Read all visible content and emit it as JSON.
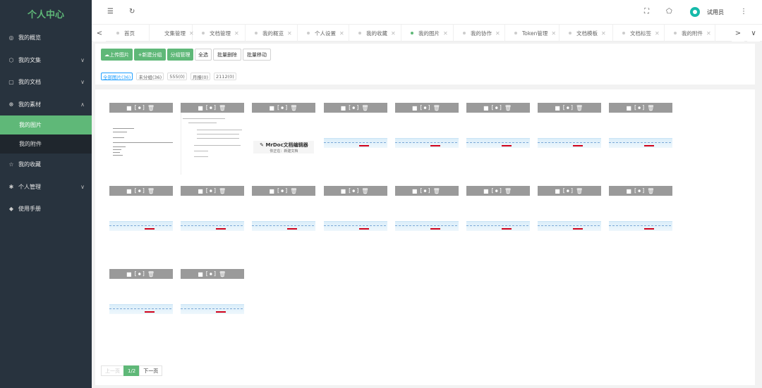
{
  "app": {
    "title": "个人中心"
  },
  "sidebar": {
    "items": [
      {
        "label": "我的概览",
        "icon": "dashboard-icon",
        "glyph": "◎"
      },
      {
        "label": "我的文集",
        "icon": "cube-icon",
        "glyph": "⬡",
        "chevron": "∨"
      },
      {
        "label": "我的文档",
        "icon": "document-icon",
        "glyph": "▢",
        "chevron": "∨"
      },
      {
        "label": "我的素材",
        "icon": "palette-icon",
        "glyph": "☸",
        "chevron": "∧"
      },
      {
        "label": "我的收藏",
        "icon": "star-icon",
        "glyph": "☆"
      },
      {
        "label": "个人管理",
        "icon": "gear-icon",
        "glyph": "✱",
        "chevron": "∨"
      },
      {
        "label": "使用手册",
        "icon": "layers-icon",
        "glyph": "◆"
      }
    ],
    "submenu": [
      {
        "label": "我的图片",
        "active": true
      },
      {
        "label": "我的附件",
        "active": false
      }
    ]
  },
  "topbar": {
    "menu_icon": "☰",
    "refresh_icon": "↻",
    "fullscreen_icon": "⛶",
    "theme_icon": "⬠",
    "more_icon": "⋮",
    "username": "试用员"
  },
  "tabs": {
    "prev": "<",
    "next": ">",
    "menu": "∨",
    "close": "✕",
    "items": [
      {
        "label": "首页",
        "closable": false
      },
      {
        "label": "文集管理",
        "closable": true
      },
      {
        "label": "文档管理",
        "closable": true
      },
      {
        "label": "我的概览",
        "closable": true
      },
      {
        "label": "个人设置",
        "closable": true
      },
      {
        "label": "我的收藏",
        "closable": true
      },
      {
        "label": "我的图片",
        "closable": true,
        "active": true
      },
      {
        "label": "我的协作",
        "closable": true
      },
      {
        "label": "Token管理",
        "closable": true
      },
      {
        "label": "文档模板",
        "closable": true
      },
      {
        "label": "文档标签",
        "closable": true
      },
      {
        "label": "我的附件",
        "closable": true
      }
    ]
  },
  "toolbar": {
    "upload": "☁上传图片",
    "new_group": "+新建分组",
    "group_manage": "分组管理",
    "select_all": "全选",
    "batch_delete": "批量删除",
    "batch_move": "批量移动"
  },
  "filters": [
    {
      "label": "全部图片(36)",
      "selected": true
    },
    {
      "label": "未分组(36)",
      "selected": false
    },
    {
      "label": "555(0)",
      "selected": false
    },
    {
      "label": "月报(0)",
      "selected": false
    },
    {
      "label": "2112(0)",
      "selected": false
    }
  ],
  "card_actions": {
    "checkbox": "■",
    "copy": "[⦁]",
    "delete": "🗑"
  },
  "images": [
    {
      "kind": "doc"
    },
    {
      "kind": "table"
    },
    {
      "kind": "mrdoc"
    },
    {
      "kind": "strip"
    },
    {
      "kind": "strip"
    },
    {
      "kind": "strip"
    },
    {
      "kind": "strip"
    },
    {
      "kind": "strip"
    },
    {
      "kind": "strip"
    },
    {
      "kind": "strip"
    },
    {
      "kind": "strip"
    },
    {
      "kind": "strip"
    },
    {
      "kind": "strip"
    },
    {
      "kind": "strip"
    },
    {
      "kind": "strip"
    },
    {
      "kind": "strip"
    },
    {
      "kind": "strip"
    },
    {
      "kind": "strip"
    }
  ],
  "mrdoc": {
    "title": "✎ MrDoc文档编辑器",
    "subtitle": "你正在：新建文档"
  },
  "pager": {
    "prev": "上一页",
    "current": "1/2",
    "next": "下一页"
  }
}
